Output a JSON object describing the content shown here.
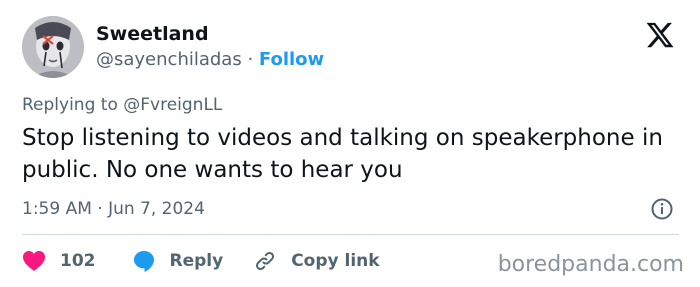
{
  "author": {
    "name": "Sweetland",
    "handle": "@sayenchiladas",
    "separator": " · ",
    "follow_label": "Follow",
    "avatar_icon": "profile-photo"
  },
  "reply_context": {
    "prefix": "Replying to ",
    "mention": "@FvreignLL"
  },
  "tweet": {
    "text": "Stop listening to videos and talking on speakerphone in public. No one wants to hear you",
    "timestamp": "1:59 AM · Jun 7, 2024"
  },
  "actions": {
    "like_count": "102",
    "reply_label": "Reply",
    "copy_label": "Copy link"
  },
  "watermark": "boredpanda.com",
  "colors": {
    "like": "#f91880",
    "reply": "#1d9bf0",
    "link": "#1d9bf0",
    "muted": "#536471"
  }
}
